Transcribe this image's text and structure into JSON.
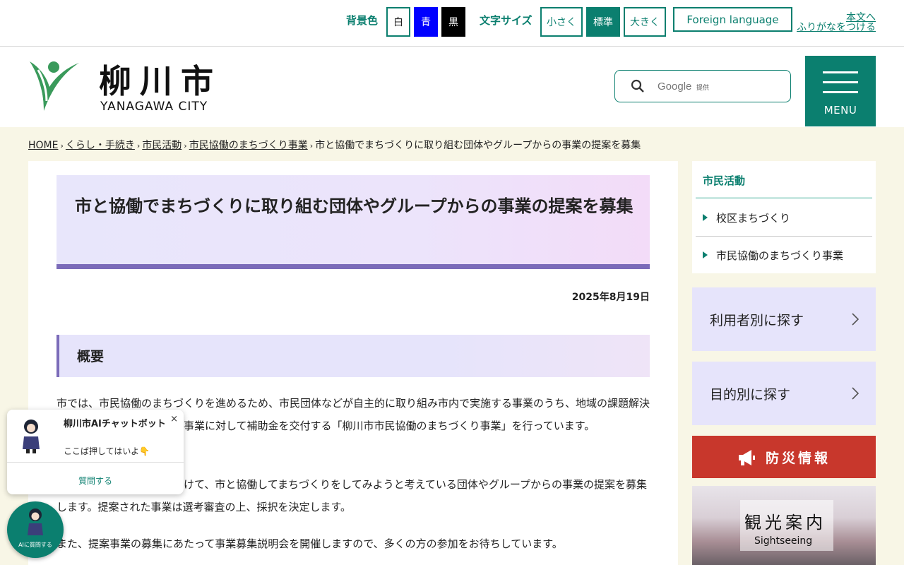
{
  "utility": {
    "bg_label": "背景色",
    "bg_white": "白",
    "bg_blue": "青",
    "bg_black": "黒",
    "text_size_label": "文字サイズ",
    "size_small": "小さく",
    "size_normal": "標準",
    "size_large": "大きく",
    "foreign": "Foreign language",
    "main_text": "本文へ",
    "furigana": "ふりがなをつける"
  },
  "header": {
    "logo_jp": "柳川市",
    "logo_en": "YANAGAWA CITY",
    "search_placeholder": "Google",
    "search_provided": "提供",
    "menu_label": "MENU"
  },
  "breadcrumb": [
    "HOME",
    "くらし・手続き",
    "市民活動",
    "市民協働のまちづくり事業",
    "市と協働でまちづくりに取り組む団体やグループからの事業の提案を募集"
  ],
  "main": {
    "title": "市と協働でまちづくりに取り組む団体やグループからの事業の提案を募集",
    "date": "2025年8月19日",
    "section_heading": "概要",
    "para1": "市では、市民協働のまちづくりを進めるため、市民団体などが自主的に取り組み市内で実施する事業のうち、地域の課題解決等に寄与する公共性の高い事業に対して補助金を交付する「柳川市市民協働のまちづくり事業」を行っています。",
    "para2": "このたび、事業の実施に向けて、市と協働してまちづくりをしてみようと考えている団体やグループからの事業の提案を募集します。提案された事業は選考審査の上、採択を決定します。",
    "para3": "また、提案事業の募集にあたって事業募集説明会を開催しますので、多くの方の参加をお待ちしています。"
  },
  "sidebar": {
    "nav_title": "市民活動",
    "nav_items": [
      "校区まちづくり",
      "市民協働のまちづくり事業"
    ],
    "card_user": "利用者別に探す",
    "card_purpose": "目的別に探す",
    "bousai": "防災情報",
    "kanko_jp": "観光案内",
    "kanko_en": "Sightseeing"
  },
  "chat": {
    "name": "柳川市AIチャットボット",
    "close": "×",
    "message": "ここば押してはいよ👇",
    "ask": "質問する",
    "fab_label": "AIに質問する"
  },
  "colors": {
    "brand": "#0b7f6f",
    "accent_purple": "#7b6bb9",
    "bousai_red": "#c8372c",
    "cream": "#f8f6e6"
  }
}
